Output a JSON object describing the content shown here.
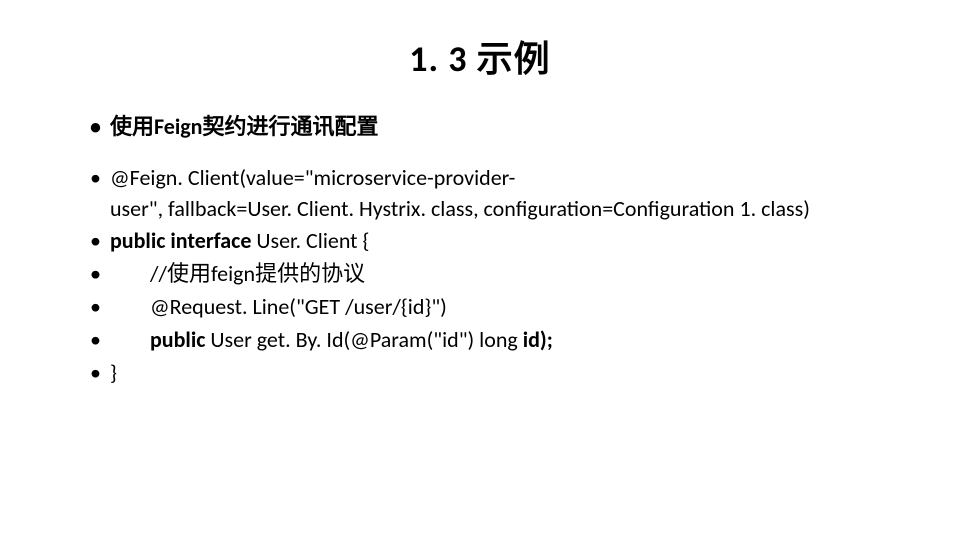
{
  "title": "1. 3 示例",
  "bullets": {
    "b1": "使用Feign契约进行通讯配置",
    "b2a": "@Feign. Client(value=\"microservice-provider-",
    "b2b": "user\", fallback=User. Client. Hystrix. class, configuration=Configuration 1. class)",
    "b3_prefix": "public interface ",
    "b3_suffix": "User. Client {",
    "b4": "",
    "b5": "//使用feign提供的协议",
    "b6": "@Request. Line(\"GET /user/{id}\")",
    "b7_prefix": "public ",
    "b7_mid": "User get. By. Id(@Param(\"id\") long ",
    "b7_suffix": "id);",
    "b8": "}"
  }
}
